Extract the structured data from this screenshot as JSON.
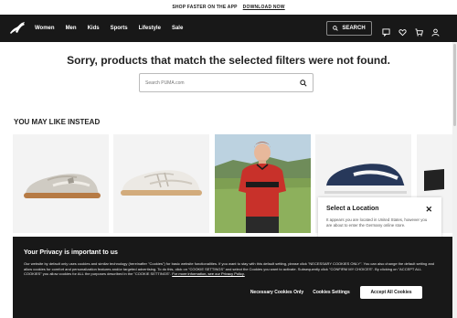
{
  "promo": {
    "text": "SHOP FASTER ON THE APP",
    "link": "DOWNLOAD NOW"
  },
  "nav": {
    "menu": [
      "Women",
      "Men",
      "Kids",
      "Sports",
      "Lifestyle",
      "Sale"
    ],
    "search_label": "SEARCH",
    "icons": [
      "chat-icon",
      "heart-icon",
      "cart-icon",
      "user-icon"
    ]
  },
  "main": {
    "message": "Sorry, products that match the selected filters were not found.",
    "search_placeholder": "Search PUMA.com",
    "recommend_title": "YOU MAY LIKE INSTEAD"
  },
  "products": [
    {
      "name": "grey-suede-sneaker"
    },
    {
      "name": "white-strap-sneaker"
    },
    {
      "name": "model-in-red-jersey"
    },
    {
      "name": "navy-suede-sneaker"
    }
  ],
  "location_modal": {
    "title": "Select a Location",
    "body": "It appears you are located in United States, however you are about to enter the Germany online store."
  },
  "cookie": {
    "title": "Your Privacy is important to us",
    "body": "Our website by default only uses cookies and similar technology (hereinafter \"Cookies\") for basic website functionalities. If you want to stay with this default setting, please click \"NECESSARY COOKIES ONLY\". You can also change the default setting and allow cookies for comfort and personalization features and/or targeted advertising. To do this, click on \"COOKIE SETTINGS\" and select the Cookies you want to activate. Subsequently click \"CONFIRM MY CHOICES\". By clicking on \"ACCEPT ALL COOKIES\" you allow cookies for ALL the purposes described in the \"COOKIE SETTINGS\".",
    "link": "For more information, see our Privacy Policy.",
    "buttons": {
      "necessary": "Necessary Cookies Only",
      "settings": "Cookies Settings",
      "accept": "Accept All Cookies"
    }
  },
  "colors": {
    "nav_bg": "#181818",
    "cookie_bg": "#181818",
    "jersey_red": "#c8312a"
  }
}
